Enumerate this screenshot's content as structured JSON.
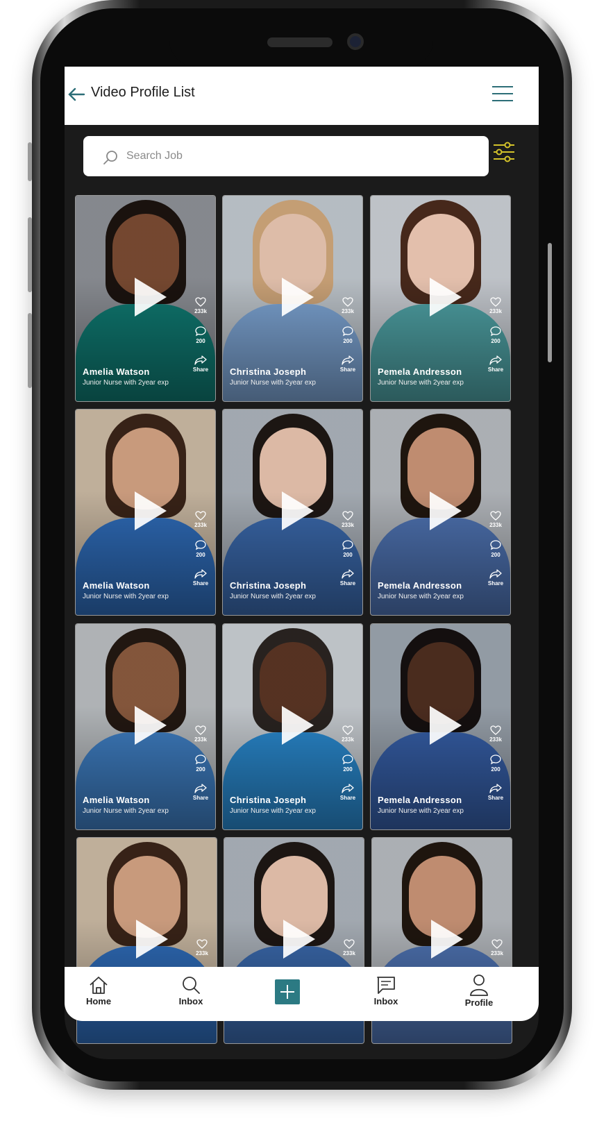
{
  "header": {
    "title": "Video Profile List"
  },
  "search": {
    "placeholder": "Search Job"
  },
  "colors": {
    "accent": "#2c7a83",
    "filter": "#d4c32a",
    "header_text": "#1d1d1d"
  },
  "cards": [
    {
      "name": "Amelia Watson",
      "subtitle": "Junior Nurse with 2year exp",
      "likes": "233k",
      "comments": "200",
      "share": "Share",
      "skin": "#7a4b32",
      "hair": "#1b130f",
      "scrubs": "#0f7a72",
      "bg": "#8c8f95"
    },
    {
      "name": "Christina Joseph",
      "subtitle": "Junior Nurse with 2year exp",
      "likes": "233k",
      "comments": "200",
      "share": "Share",
      "skin": "#e9c6b1",
      "hair": "#cfa67a",
      "scrubs": "#7ea6d6",
      "bg": "#bfc6cc"
    },
    {
      "name": "Pemela Andresson",
      "subtitle": "Junior Nurse with 2year exp",
      "likes": "233k",
      "comments": "200",
      "share": "Share",
      "skin": "#efc9b5",
      "hair": "#4a2a1c",
      "scrubs": "#4fa3a6",
      "bg": "#c8ccd2"
    },
    {
      "name": "Amelia Watson",
      "subtitle": "Junior Nurse with 2year exp",
      "likes": "233k",
      "comments": "200",
      "share": "Share",
      "skin": "#d3a283",
      "hair": "#3a2418",
      "scrubs": "#2f6dbb",
      "bg": "#c9b8a2"
    },
    {
      "name": "Christina Joseph",
      "subtitle": "Junior Nurse with 2year exp",
      "likes": "233k",
      "comments": "200",
      "share": "Share",
      "skin": "#e8c3ae",
      "hair": "#1e1714",
      "scrubs": "#3b6aae",
      "bg": "#aab1b9"
    },
    {
      "name": "Pemela Andresson",
      "subtitle": "Junior Nurse with 2year exp",
      "likes": "233k",
      "comments": "200",
      "share": "Share",
      "skin": "#c99376",
      "hair": "#20160f",
      "scrubs": "#4f74b4",
      "bg": "#b4b8bd"
    },
    {
      "name": "Amelia Watson",
      "subtitle": "Junior Nurse with 2year exp",
      "likes": "233k",
      "comments": "200",
      "share": "Share",
      "skin": "#8a5a3e",
      "hair": "#231812",
      "scrubs": "#3f7fc4",
      "bg": "#b8bcbf"
    },
    {
      "name": "Christina Joseph",
      "subtitle": "Junior Nurse with 2year exp",
      "likes": "233k",
      "comments": "200",
      "share": "Share",
      "skin": "#5a3524",
      "hair": "#2a2421",
      "scrubs": "#2a8ad0",
      "bg": "#c7ccd1"
    },
    {
      "name": "Pemela Andresson",
      "subtitle": "Junior Nurse with 2year exp",
      "likes": "233k",
      "comments": "200",
      "share": "Share",
      "skin": "#4e2e20",
      "hair": "#151010",
      "scrubs": "#365fa8",
      "bg": "#9aa3ad"
    },
    {
      "name": "",
      "subtitle": "",
      "likes": "233k",
      "comments": "",
      "share": "",
      "skin": "#d3a283",
      "hair": "#3a2418",
      "scrubs": "#2f6dbb",
      "bg": "#c9b8a2"
    },
    {
      "name": "",
      "subtitle": "",
      "likes": "233k",
      "comments": "",
      "share": "",
      "skin": "#e8c3ae",
      "hair": "#1e1714",
      "scrubs": "#3b6aae",
      "bg": "#aab1b9"
    },
    {
      "name": "",
      "subtitle": "",
      "likes": "233k",
      "comments": "",
      "share": "",
      "skin": "#c99376",
      "hair": "#20160f",
      "scrubs": "#4f74b4",
      "bg": "#b4b8bd"
    }
  ],
  "nav": [
    {
      "label": "Home",
      "icon": "home-icon"
    },
    {
      "label": "Inbox",
      "icon": "search-icon"
    },
    {
      "label": "",
      "icon": "add-icon"
    },
    {
      "label": "Inbox",
      "icon": "message-icon"
    },
    {
      "label": "Profile",
      "icon": "profile-icon"
    }
  ]
}
